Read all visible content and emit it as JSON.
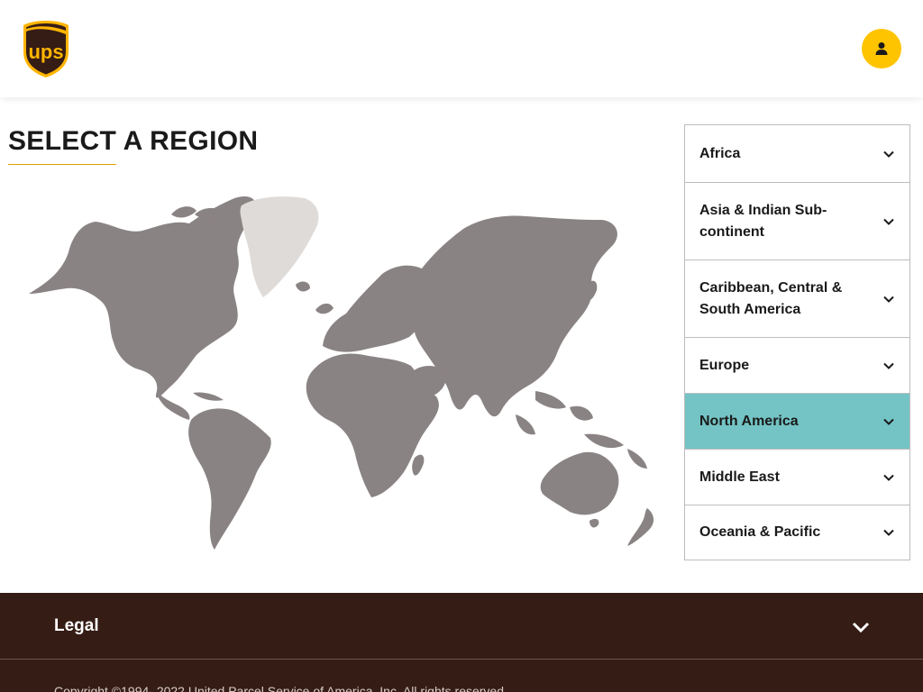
{
  "header": {
    "logo_text": "ups",
    "logo_icon": "ups-shield-logo",
    "profile_icon": "user-icon"
  },
  "page": {
    "title": "SELECT A REGION"
  },
  "regions": [
    {
      "label": "Africa",
      "active": false
    },
    {
      "label": "Asia & Indian Sub-continent",
      "active": false
    },
    {
      "label": "Caribbean, Central & South America",
      "active": false
    },
    {
      "label": "Europe",
      "active": false
    },
    {
      "label": "North America",
      "active": true
    },
    {
      "label": "Middle East",
      "active": false
    },
    {
      "label": "Oceania & Pacific",
      "active": false
    }
  ],
  "footer": {
    "legal_label": "Legal",
    "copyright": "Copyright ©1994- 2022  United Parcel Service of America, Inc. All rights reserved."
  },
  "colors": {
    "brand_brown": "#351c15",
    "brand_gold": "#ffc400",
    "active_region": "#74c4c5",
    "map_land": "#8a8384",
    "map_greenland": "#dedbd8"
  }
}
